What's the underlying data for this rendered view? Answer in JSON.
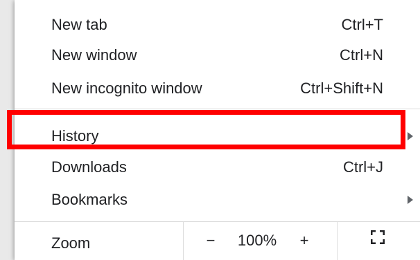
{
  "menu": {
    "items": [
      {
        "label": "New tab",
        "shortcut": "Ctrl+T"
      },
      {
        "label": "New window",
        "shortcut": "Ctrl+N"
      },
      {
        "label": "New incognito window",
        "shortcut": "Ctrl+Shift+N"
      },
      {
        "label": "History",
        "shortcut": "",
        "submenu": true
      },
      {
        "label": "Downloads",
        "shortcut": "Ctrl+J"
      },
      {
        "label": "Bookmarks",
        "shortcut": "",
        "submenu": true
      }
    ],
    "zoom": {
      "label": "Zoom",
      "minus": "−",
      "value": "100%",
      "plus": "+"
    }
  },
  "highlight_color": "#ff0000"
}
